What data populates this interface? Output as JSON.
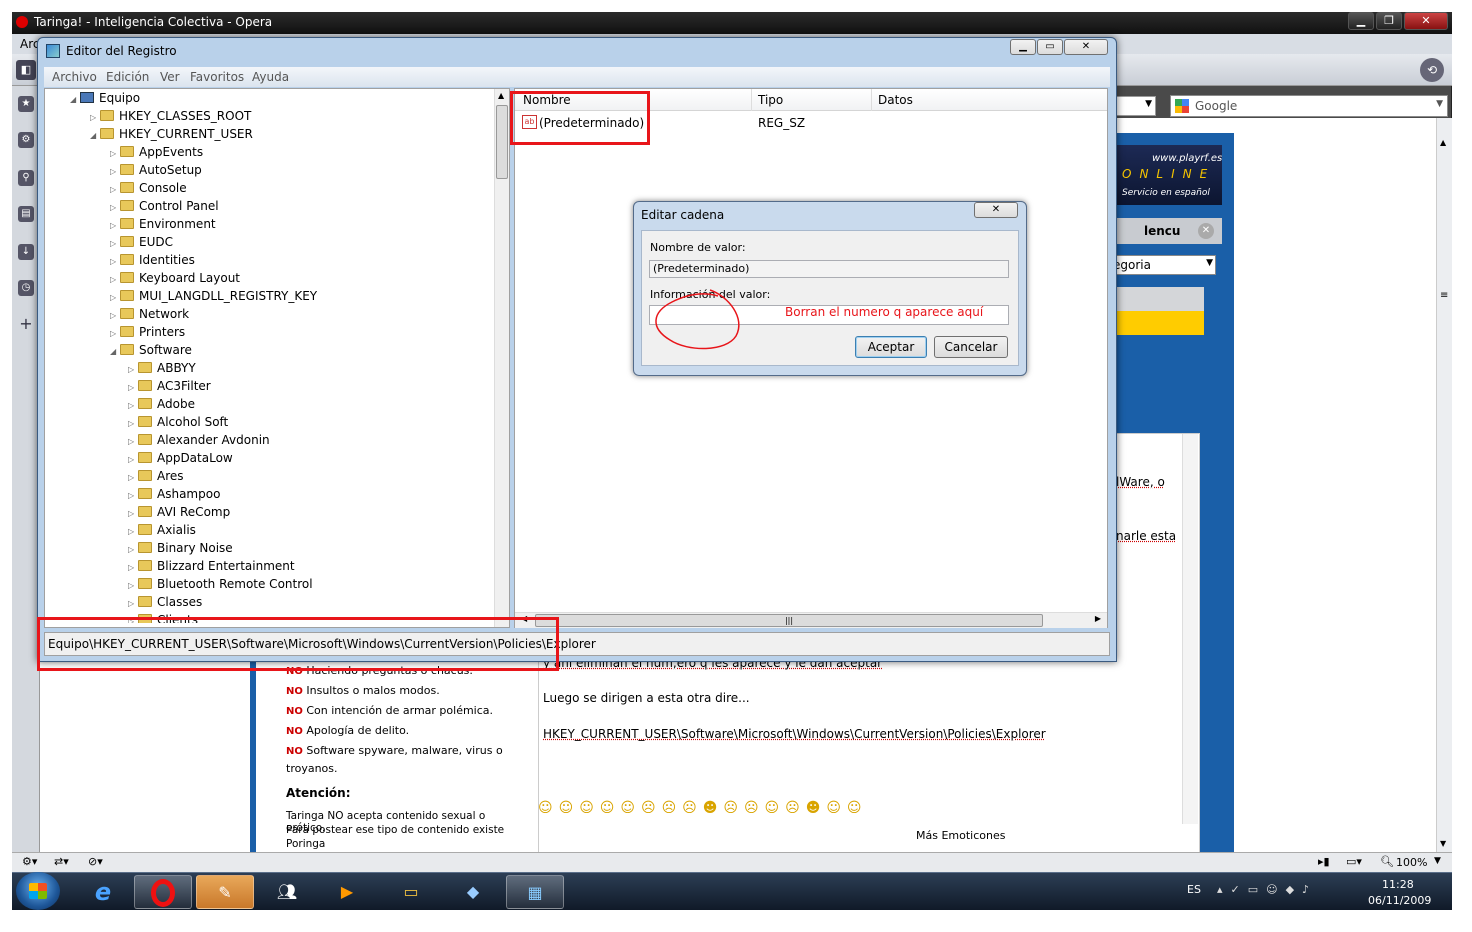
{
  "opera": {
    "title": "Taringa! - Inteligencia Colectiva - Opera",
    "menu_first": "Arc",
    "search_engine": "Google",
    "window_controls": [
      "minimize",
      "maximize",
      "close"
    ]
  },
  "regedit": {
    "title": "Editor del Registro",
    "menu": [
      "Archivo",
      "Edición",
      "Ver",
      "Favoritos",
      "Ayuda"
    ],
    "tree": [
      {
        "label": "Equipo",
        "level": 0,
        "folder": false
      },
      {
        "label": "HKEY_CLASSES_ROOT",
        "level": 1
      },
      {
        "label": "HKEY_CURRENT_USER",
        "level": 1
      },
      {
        "label": "AppEvents",
        "level": 2
      },
      {
        "label": "AutoSetup",
        "level": 2
      },
      {
        "label": "Console",
        "level": 2
      },
      {
        "label": "Control Panel",
        "level": 2
      },
      {
        "label": "Environment",
        "level": 2
      },
      {
        "label": "EUDC",
        "level": 2
      },
      {
        "label": "Identities",
        "level": 2
      },
      {
        "label": "Keyboard Layout",
        "level": 2
      },
      {
        "label": "MUI_LANGDLL_REGISTRY_KEY",
        "level": 2
      },
      {
        "label": "Network",
        "level": 2
      },
      {
        "label": "Printers",
        "level": 2
      },
      {
        "label": "Software",
        "level": 2
      },
      {
        "label": "ABBYY",
        "level": 3
      },
      {
        "label": "AC3Filter",
        "level": 3
      },
      {
        "label": "Adobe",
        "level": 3
      },
      {
        "label": "Alcohol Soft",
        "level": 3
      },
      {
        "label": "Alexander Avdonin",
        "level": 3
      },
      {
        "label": "AppDataLow",
        "level": 3
      },
      {
        "label": "Ares",
        "level": 3
      },
      {
        "label": "Ashampoo",
        "level": 3
      },
      {
        "label": "AVI ReComp",
        "level": 3
      },
      {
        "label": "Axialis",
        "level": 3
      },
      {
        "label": "Binary Noise",
        "level": 3
      },
      {
        "label": "Blizzard Entertainment",
        "level": 3
      },
      {
        "label": "Bluetooth Remote Control",
        "level": 3
      },
      {
        "label": "Classes",
        "level": 3
      },
      {
        "label": "Clients",
        "level": 3
      }
    ],
    "columns": {
      "name": "Nombre",
      "type": "Tipo",
      "data": "Datos"
    },
    "values": [
      {
        "name": "(Predeterminado)",
        "type": "REG_SZ",
        "data": ""
      }
    ],
    "status_path": "Equipo\\HKEY_CURRENT_USER\\Software\\Microsoft\\Windows\\CurrentVersion\\Policies\\Explorer"
  },
  "dialog": {
    "title": "Editar cadena",
    "value_name_label": "Nombre de valor:",
    "value_name": "(Predeterminado)",
    "value_data_label": "Información del valor:",
    "annotation": "Borran el numero q aparece aquí",
    "ok": "Aceptar",
    "cancel": "Cancelar"
  },
  "page": {
    "ad_url": "www.playrf.es",
    "ad_line2": "ONLINE",
    "ad_line3": "Servicio en español",
    "lencu": "lencu",
    "categoria": "egoria",
    "text_fragment1": "lWare, o",
    "text_fragment2": "narle esta",
    "post_line1": "y ahi eliminan el num,ero q les aparece y le dan aceptar",
    "post_line2": "Luego se dirigen a esta otra dire...",
    "post_path": "HKEY_CURRENT_USER\\Software\\Microsoft\\Windows\\CurrentVersion\\Policies\\Explorer",
    "mas_emoticones": "Más Emoticones",
    "rules": [
      {
        "no": "NO",
        "text": "Haciendo preguntas o chacus."
      },
      {
        "no": "NO",
        "text": "Insultos o malos modos."
      },
      {
        "no": "NO",
        "text": "Con intención de armar polémica."
      },
      {
        "no": "NO",
        "text": "Apología de delito."
      },
      {
        "no": "NO",
        "text": "Software spyware, malware, virus o"
      },
      {
        "no": "",
        "text": "troyanos."
      }
    ],
    "atencion": "Atención:",
    "atencion_text1": "Taringa NO acepta contenido sexual o erótico.",
    "atencion_text2": "Para postear ese tipo de contenido existe",
    "atencion_text3": "Poringa"
  },
  "statusbar": {
    "zoom": "100%"
  },
  "taskbar": {
    "lang": "ES",
    "time": "11:28",
    "date": "06/11/2009"
  },
  "colors": {
    "annotation_red": "#e8151a",
    "taringa_blue": "#1a5fa8"
  }
}
